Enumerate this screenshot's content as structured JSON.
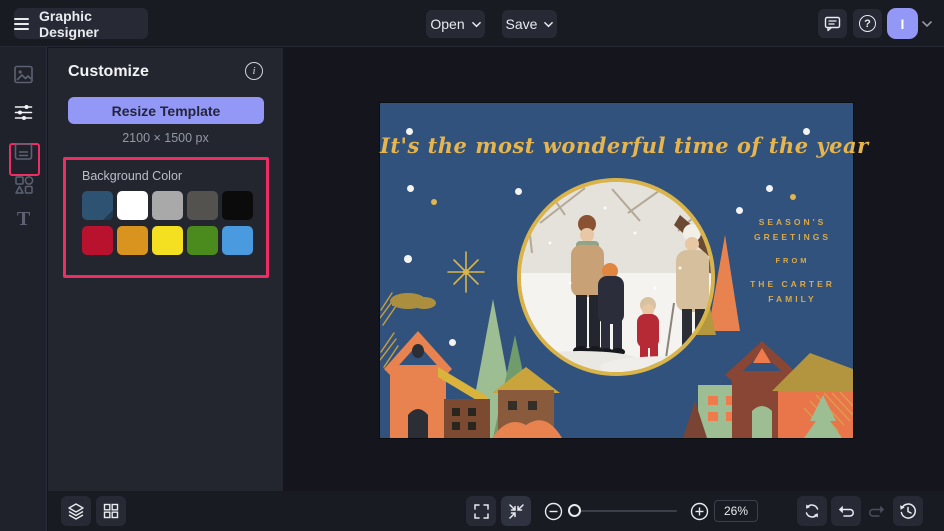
{
  "topbar": {
    "app_title": "Graphic Designer",
    "open_label": "Open",
    "save_label": "Save",
    "avatar_initial": "I"
  },
  "sidebar": {
    "items": [
      {
        "id": "images",
        "icon": "image-icon",
        "active": false
      },
      {
        "id": "customize",
        "icon": "sliders-icon",
        "active": true
      },
      {
        "id": "templates",
        "icon": "panel-icon",
        "active": false
      },
      {
        "id": "graphics",
        "icon": "shapes-icon",
        "active": false
      },
      {
        "id": "text",
        "icon": "text-icon",
        "active": false
      }
    ],
    "text_tool_glyph": "T"
  },
  "panel": {
    "title": "Customize",
    "info_glyph": "i",
    "resize_button": "Resize Template",
    "dimensions": "2100 × 1500 px",
    "background_label": "Background Color",
    "swatches": [
      {
        "name": "current-blue",
        "hex": "#2e5271",
        "selected": true
      },
      {
        "name": "white",
        "hex": "#ffffff",
        "selected": false
      },
      {
        "name": "light-gray",
        "hex": "#a9a9a9",
        "selected": false
      },
      {
        "name": "dark-gray",
        "hex": "#54524e",
        "selected": false
      },
      {
        "name": "black",
        "hex": "#0b0b0b",
        "selected": false
      },
      {
        "name": "red",
        "hex": "#b8122e",
        "selected": false
      },
      {
        "name": "orange",
        "hex": "#d9941f",
        "selected": false
      },
      {
        "name": "yellow",
        "hex": "#f4df20",
        "selected": false
      },
      {
        "name": "green",
        "hex": "#4b8b1d",
        "selected": false
      },
      {
        "name": "blue",
        "hex": "#4a9ae0",
        "selected": false
      }
    ]
  },
  "card": {
    "background": "#31527c",
    "title": "It's the most wonderful time of the year",
    "greeting_line1": "SEASON'S",
    "greeting_line2": "GREETINGS",
    "greeting_from": "FROM",
    "greeting_line3": "THE CARTER",
    "greeting_line4": "FAMILY",
    "accent_gold": "#e6b54d"
  },
  "bottombar": {
    "zoom_percent": "26%"
  },
  "help_glyph": "?"
}
